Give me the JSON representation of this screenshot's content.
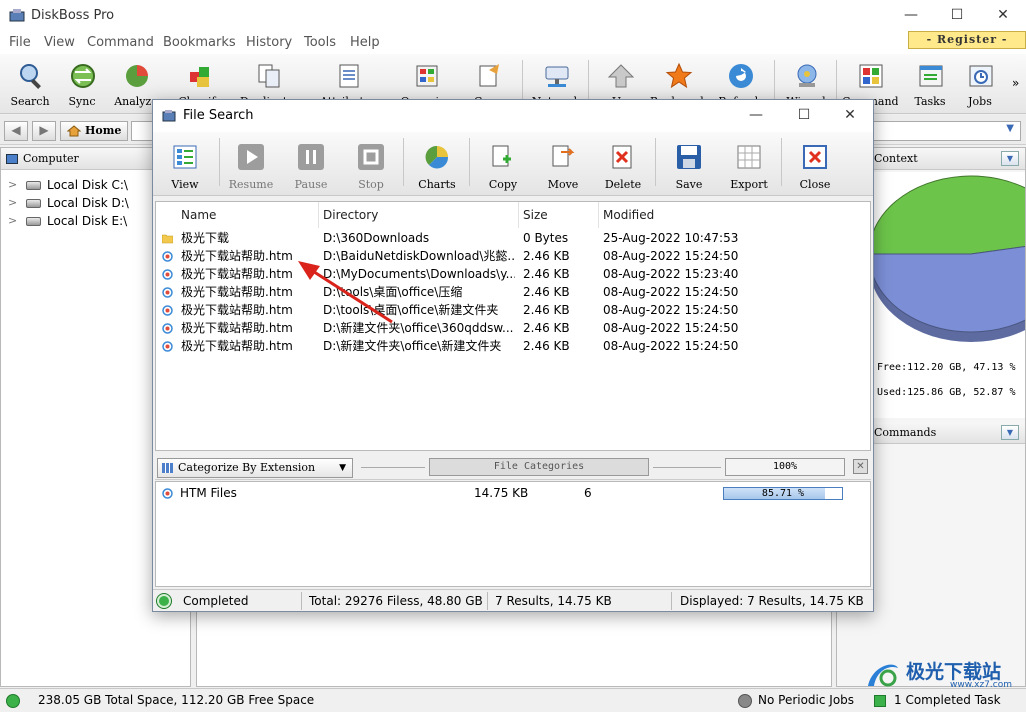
{
  "app": {
    "title": "DiskBoss Pro",
    "register": "- Register -"
  },
  "window_controls": {
    "minimize": "—",
    "maximize": "☐",
    "close": "✕"
  },
  "menu": [
    "File",
    "View",
    "Command",
    "Bookmarks",
    "History",
    "Tools",
    "Help"
  ],
  "toolbar": [
    {
      "label": "Search",
      "icon": "search-icon"
    },
    {
      "label": "Sync",
      "icon": "sync-icon"
    },
    {
      "label": "Analyze",
      "icon": "analyze-icon"
    },
    {
      "label": "Classify",
      "icon": "classify-icon"
    },
    {
      "label": "Duplicates",
      "icon": "duplicates-icon"
    },
    {
      "label": "Attributes",
      "icon": "attributes-icon"
    },
    {
      "label": "Organize",
      "icon": "organize-icon"
    },
    {
      "label": "Copy",
      "icon": "copy-icon"
    },
    {
      "label": "Network",
      "icon": "network-icon"
    },
    {
      "label": "Up",
      "icon": "up-icon"
    },
    {
      "label": "Bookmark",
      "icon": "bookmark-icon"
    },
    {
      "label": "Refresh",
      "icon": "refresh-icon"
    },
    {
      "label": "Wizard",
      "icon": "wizard-icon"
    },
    {
      "label": "Commands",
      "icon": "commands-icon"
    },
    {
      "label": "Tasks",
      "icon": "tasks-icon"
    },
    {
      "label": "Jobs",
      "icon": "jobs-icon"
    }
  ],
  "toolbar_more": "»",
  "nav": {
    "back": "◀",
    "forward": "▶",
    "home": "Home",
    "dropdown": "▼"
  },
  "left_panel": {
    "header": "Computer",
    "items": [
      {
        "label": "Local Disk C:\\"
      },
      {
        "label": "Local Disk D:\\"
      },
      {
        "label": "Local Disk E:\\"
      }
    ]
  },
  "right_panel": {
    "header1": "Context",
    "header2": "Commands",
    "free": "Free:112.20 GB, 47.13 %",
    "used": "Used:125.86 GB, 52.87 %"
  },
  "chart_data": {
    "type": "pie",
    "title": "",
    "slices": [
      {
        "label": "Free",
        "value": 47.13,
        "color": "#6cc44a"
      },
      {
        "label": "Used",
        "value": 52.87,
        "color": "#7c8fd6"
      }
    ]
  },
  "status": {
    "space": "238.05 GB Total Space, 112.20 GB Free Space",
    "periodic": "No Periodic Jobs",
    "task": "1 Completed Task"
  },
  "dialog": {
    "title": "File Search",
    "controls": {
      "minimize": "—",
      "maximize": "☐",
      "close": "✕"
    },
    "toolbar": [
      {
        "label": "View",
        "icon": "view-icon",
        "enabled": true
      },
      {
        "label": "Resume",
        "icon": "resume-icon",
        "enabled": false
      },
      {
        "label": "Pause",
        "icon": "pause-icon",
        "enabled": false
      },
      {
        "label": "Stop",
        "icon": "stop-icon",
        "enabled": false
      },
      {
        "label": "Charts",
        "icon": "charts-icon",
        "enabled": true
      },
      {
        "label": "Copy",
        "icon": "copy-icon",
        "enabled": true
      },
      {
        "label": "Move",
        "icon": "move-icon",
        "enabled": true
      },
      {
        "label": "Delete",
        "icon": "delete-icon",
        "enabled": true
      },
      {
        "label": "Save",
        "icon": "save-icon",
        "enabled": true
      },
      {
        "label": "Export",
        "icon": "export-icon",
        "enabled": true
      },
      {
        "label": "Close",
        "icon": "close-icon",
        "enabled": true
      }
    ],
    "columns": [
      "Name",
      "Directory",
      "Size",
      "Modified"
    ],
    "rows": [
      {
        "type": "folder",
        "name": "极光下载",
        "dir": "D:\\360Downloads",
        "size": "0 Bytes",
        "modified": "25-Aug-2022 10:47:53"
      },
      {
        "type": "htm",
        "name": "极光下载站帮助.htm",
        "dir": "D:\\BaiduNetdiskDownload\\兆懿...",
        "size": "2.46 KB",
        "modified": "08-Aug-2022 15:24:50"
      },
      {
        "type": "htm",
        "name": "极光下载站帮助.htm",
        "dir": "D:\\MyDocuments\\Downloads\\y...",
        "size": "2.46 KB",
        "modified": "08-Aug-2022 15:23:40"
      },
      {
        "type": "htm",
        "name": "极光下载站帮助.htm",
        "dir": "D:\\tools\\桌面\\office\\压缩",
        "size": "2.46 KB",
        "modified": "08-Aug-2022 15:24:50"
      },
      {
        "type": "htm",
        "name": "极光下载站帮助.htm",
        "dir": "D:\\tools\\桌面\\office\\新建文件夹",
        "size": "2.46 KB",
        "modified": "08-Aug-2022 15:24:50"
      },
      {
        "type": "htm",
        "name": "极光下载站帮助.htm",
        "dir": "D:\\新建文件夹\\office\\360qddsw...",
        "size": "2.46 KB",
        "modified": "08-Aug-2022 15:24:50"
      },
      {
        "type": "htm",
        "name": "极光下载站帮助.htm",
        "dir": "D:\\新建文件夹\\office\\新建文件夹",
        "size": "2.46 KB",
        "modified": "08-Aug-2022 15:24:50"
      }
    ],
    "categorize": {
      "select": "Categorize By Extension",
      "title": "File Categories",
      "percent": "100%",
      "rows": [
        {
          "name": "HTM Files",
          "size": "14.75 KB",
          "count": "6",
          "percent_label": "85.71 %",
          "percent": 85.71
        }
      ]
    },
    "status": {
      "state": "Completed",
      "total": "Total: 29276 Filess, 48.80 GB",
      "results": "7 Results, 14.75 KB",
      "displayed": "Displayed: 7 Results, 14.75 KB"
    }
  },
  "watermark": {
    "cn": "极光下载站",
    "url": "www.xz7.com"
  }
}
